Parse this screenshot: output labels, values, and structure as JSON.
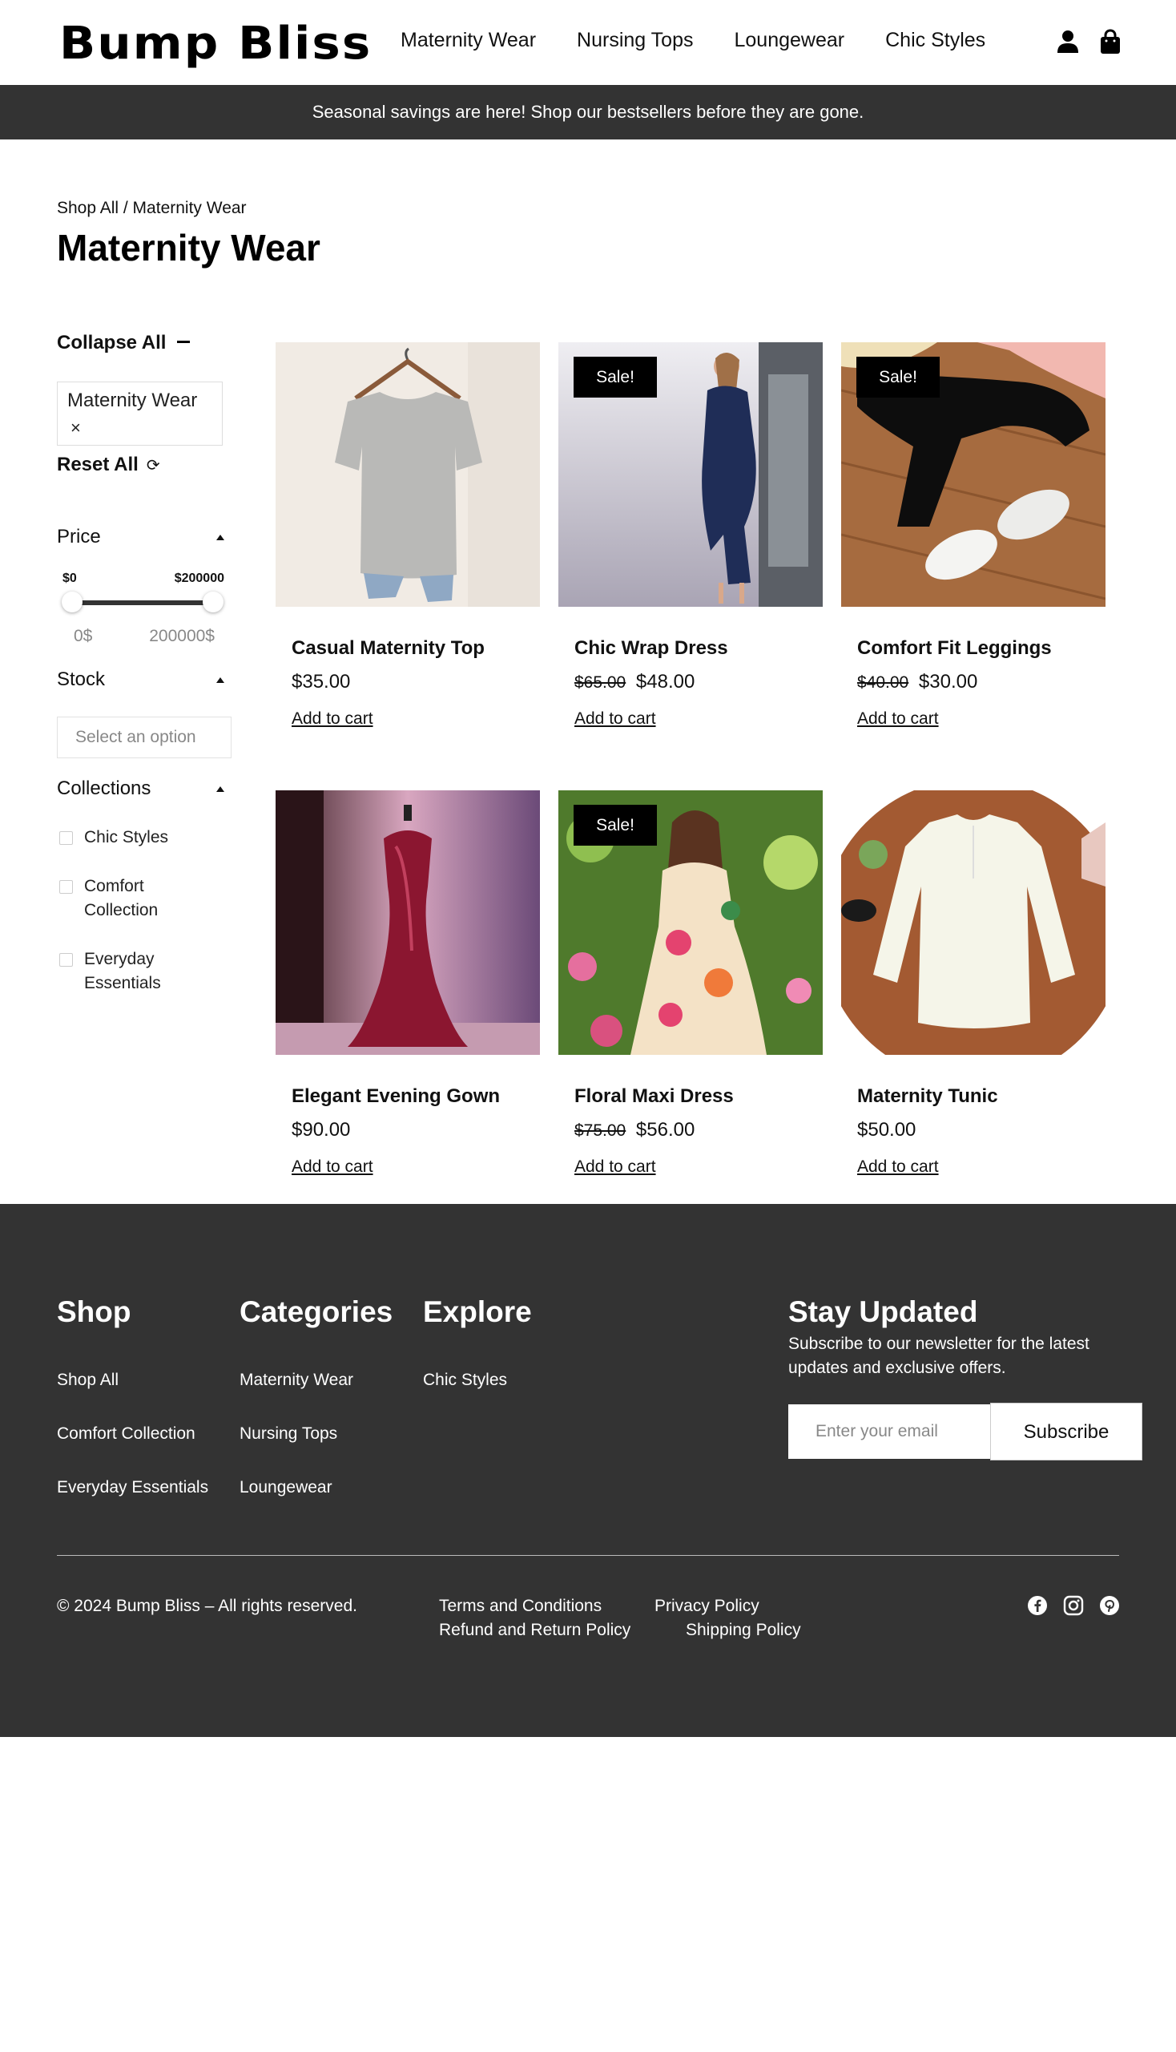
{
  "header": {
    "logo": "Bump Bliss",
    "nav": [
      "Maternity Wear",
      "Nursing Tops",
      "Loungewear",
      "Chic Styles"
    ],
    "icons": [
      "user-icon",
      "shopping-bag-icon"
    ]
  },
  "announcement": "Seasonal savings are here! Shop our bestsellers before they are gone.",
  "breadcrumb": "Shop All / Maternity Wear",
  "page_title": "Maternity Wear",
  "sidebar": {
    "collapse_all": "Collapse All",
    "active_filter": "Maternity Wear",
    "active_filter_remove": "×",
    "reset_all": "Reset All",
    "price": {
      "title": "Price",
      "min_label": "$0",
      "max_label": "$200000",
      "min_value": "0$",
      "max_value": "200000$",
      "selected_min_fraction": 0,
      "selected_max_fraction": 1
    },
    "stock": {
      "title": "Stock",
      "placeholder": "Select an option"
    },
    "collections": {
      "title": "Collections",
      "items": [
        "Chic Styles",
        "Comfort Collection",
        "Everyday Essentials"
      ]
    }
  },
  "products": [
    {
      "name": "Casual Maternity Top",
      "price": "$35.00",
      "old_price": "",
      "sale": "",
      "cart": "Add to cart"
    },
    {
      "name": "Chic Wrap Dress",
      "price": "$48.00",
      "old_price": "$65.00",
      "sale": "Sale!",
      "cart": "Add to cart"
    },
    {
      "name": "Comfort Fit Leggings",
      "price": "$30.00",
      "old_price": "$40.00",
      "sale": "Sale!",
      "cart": "Add to cart"
    },
    {
      "name": "Elegant Evening Gown",
      "price": "$90.00",
      "old_price": "",
      "sale": "",
      "cart": "Add to cart"
    },
    {
      "name": "Floral Maxi Dress",
      "price": "$56.00",
      "old_price": "$75.00",
      "sale": "Sale!",
      "cart": "Add to cart"
    },
    {
      "name": "Maternity Tunic",
      "price": "$50.00",
      "old_price": "",
      "sale": "",
      "cart": "Add to cart"
    }
  ],
  "footer": {
    "shop": {
      "title": "Shop",
      "links": [
        "Shop All",
        "Comfort Collection",
        "Everyday Essentials"
      ]
    },
    "categories": {
      "title": "Categories",
      "links": [
        "Maternity Wear",
        "Nursing Tops",
        "Loungewear"
      ]
    },
    "explore": {
      "title": "Explore",
      "links": [
        "Chic Styles"
      ]
    },
    "newsletter": {
      "title": "Stay Updated",
      "text": "Subscribe to our newsletter for the latest updates and exclusive offers.",
      "placeholder": "Enter your email",
      "button": "Subscribe"
    },
    "copyright": "© 2024 Bump Bliss – All rights reserved.",
    "legal": [
      "Terms and Conditions",
      "Privacy Policy",
      "Refund and Return Policy",
      "Shipping Policy"
    ],
    "social": [
      "facebook-icon",
      "instagram-icon",
      "pinterest-icon"
    ]
  },
  "colors": {
    "dark_band": "#333333",
    "sale_badge": "#000000",
    "text": "#111111"
  }
}
